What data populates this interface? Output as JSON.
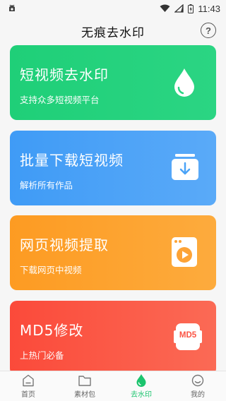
{
  "status_bar": {
    "time": "11:43"
  },
  "header": {
    "title": "无痕去水印",
    "help_label": "?"
  },
  "cards": [
    {
      "title": "短视频去水印",
      "subtitle": "支持众多短视频平台",
      "icon": "water-drop-icon"
    },
    {
      "title": "批量下载短视频",
      "subtitle": "解析所有作品",
      "icon": "download-box-icon"
    },
    {
      "title": "网页视频提取",
      "subtitle": "下载网页中视频",
      "icon": "video-page-icon"
    },
    {
      "title": "MD5修改",
      "subtitle": "上热门必备",
      "icon": "md5-icon",
      "badge": "MD5"
    }
  ],
  "bottom_nav": {
    "items": [
      {
        "label": "首页",
        "icon": "home-icon",
        "active": false
      },
      {
        "label": "素材包",
        "icon": "folder-icon",
        "active": false
      },
      {
        "label": "去水印",
        "icon": "drop-icon",
        "active": true
      },
      {
        "label": "我的",
        "icon": "profile-icon",
        "active": false
      }
    ]
  },
  "colors": {
    "green": "#1fcf78",
    "blue": "#3f9bf6",
    "orange": "#fd9b22",
    "red": "#fb4a3a",
    "active_nav": "#1cc46e"
  }
}
